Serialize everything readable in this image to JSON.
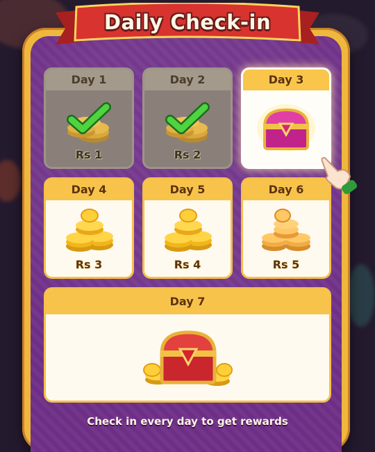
{
  "title": "Daily Check-in",
  "footer": "Check in every day to get rewards",
  "days": [
    {
      "label": "Day 1",
      "amount": "Rs 1",
      "state": "claimed",
      "reward": "coins"
    },
    {
      "label": "Day 2",
      "amount": "Rs 2",
      "state": "claimed",
      "reward": "coins"
    },
    {
      "label": "Day 3",
      "amount": "",
      "state": "today",
      "reward": "mystery-chest"
    },
    {
      "label": "Day 4",
      "amount": "Rs 3",
      "state": "locked",
      "reward": "coins"
    },
    {
      "label": "Day 5",
      "amount": "Rs 4",
      "state": "locked",
      "reward": "coins"
    },
    {
      "label": "Day 6",
      "amount": "Rs 5",
      "state": "locked",
      "reward": "coins"
    },
    {
      "label": "Day 7",
      "amount": "",
      "state": "locked",
      "reward": "big-chest"
    }
  ],
  "icons": {
    "claimed": "check-icon",
    "coins": "coin-stack-icon",
    "chest": "treasure-chest-icon",
    "pointer": "pointing-hand-icon"
  },
  "colors": {
    "panel_purple": "#6d2e86",
    "frame_gold": "#efb83d",
    "ribbon_red": "#d8332f",
    "card_header": "#f8c34a",
    "check_green": "#39c23b"
  }
}
